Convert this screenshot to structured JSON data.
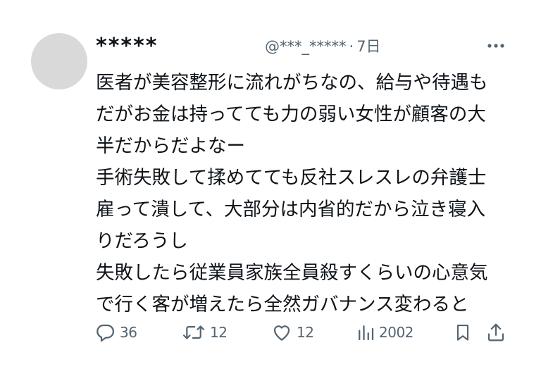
{
  "tweet": {
    "display_name": "*****",
    "handle": "@***_*****",
    "separator": "·",
    "time": "7日",
    "more_label": "•••",
    "body_lines": [
      "医者が美容整形に流れがちなの、給与や待遇も",
      "だがお金は持ってても力の弱い女性が顧客の大",
      "半だからだよなー",
      "手術失敗して揉めてても反社スレスレの弁護士",
      "雇って潰して、大部分は内省的だから泣き寝入",
      "りだろうし",
      "失敗したら従業員家族全員殺すくらいの心意気",
      "で行く客が増えたら全然ガバナンス変わると"
    ],
    "actions": {
      "reply_count": "36",
      "retweet_count": "12",
      "like_count": "12",
      "views_count": "2002"
    },
    "icons": {
      "reply": "reply-icon",
      "retweet": "retweet-icon",
      "like": "heart-icon",
      "views": "views-icon",
      "bookmark": "bookmark-icon",
      "share": "share-icon",
      "more": "more-icon"
    },
    "colors": {
      "text": "#0f1419",
      "muted": "#536471",
      "avatar": "#d9d9d9"
    }
  }
}
